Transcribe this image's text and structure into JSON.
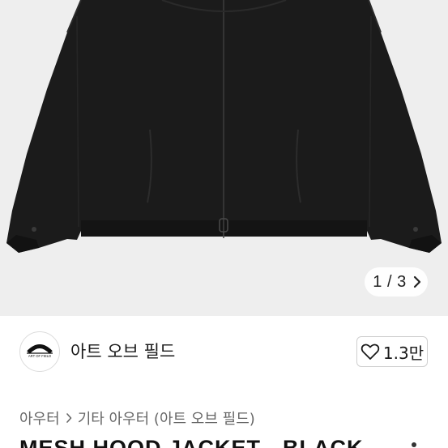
{
  "product_image": {
    "alt": "",
    "pager": {
      "current": "1",
      "total": "3",
      "text": "1 / 3"
    }
  },
  "store": {
    "name": "아트 오브 필드",
    "logo_text": "ART OF FIELD",
    "like_count": "1.3만"
  },
  "breadcrumb": {
    "items": [
      "아우터",
      "기타 아우터 (아트 오브 필드)"
    ]
  },
  "product": {
    "title": "MESH HOOD JACKET - BLACK"
  },
  "colors": {
    "image_background": "#eeeeee",
    "jacket": "#1b1b1b",
    "text_primary": "#1a1a1a",
    "text_secondary": "#666666",
    "border": "#cfcfcf"
  }
}
